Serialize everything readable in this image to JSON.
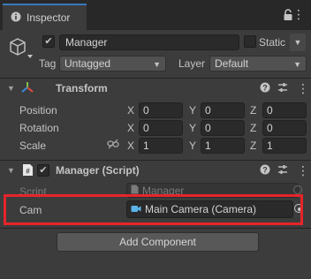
{
  "tab": {
    "title": "Inspector"
  },
  "gameobject": {
    "active": true,
    "name": "Manager",
    "static_label": "Static",
    "static": false,
    "tag_label": "Tag",
    "tag_value": "Untagged",
    "layer_label": "Layer",
    "layer_value": "Default"
  },
  "transform": {
    "title": "Transform",
    "rows": [
      {
        "label": "Position",
        "x": "0",
        "y": "0",
        "z": "0"
      },
      {
        "label": "Rotation",
        "x": "0",
        "y": "0",
        "z": "0"
      },
      {
        "label": "Scale",
        "x": "1",
        "y": "1",
        "z": "1"
      }
    ],
    "axes": {
      "x": "X",
      "y": "Y",
      "z": "Z"
    }
  },
  "script_component": {
    "enabled": true,
    "title": "Manager (Script)",
    "script_label": "Script",
    "script_value": "Manager",
    "cam_label": "Cam",
    "cam_value": "Main Camera (Camera)"
  },
  "add_component": {
    "label": "Add Component"
  },
  "colors": {
    "accent": "#3a79bb",
    "highlight": "#e6252b",
    "panel": "#3c3c3c",
    "field": "#2a2a2a"
  }
}
